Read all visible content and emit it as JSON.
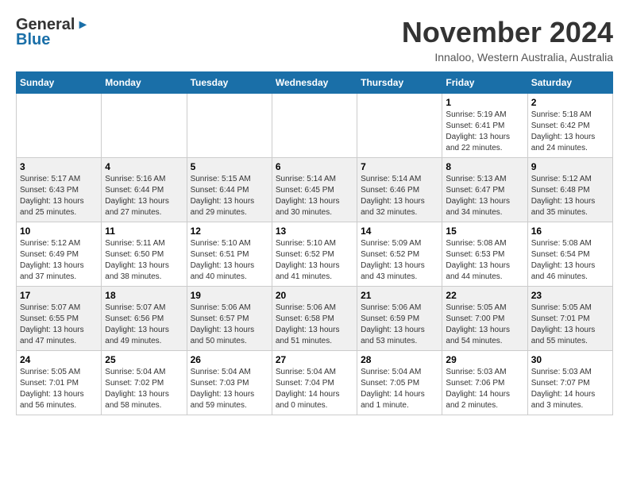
{
  "header": {
    "logo_general": "General",
    "logo_blue": "Blue",
    "month": "November 2024",
    "location": "Innaloo, Western Australia, Australia"
  },
  "weekdays": [
    "Sunday",
    "Monday",
    "Tuesday",
    "Wednesday",
    "Thursday",
    "Friday",
    "Saturday"
  ],
  "weeks": [
    [
      {
        "day": "",
        "info": ""
      },
      {
        "day": "",
        "info": ""
      },
      {
        "day": "",
        "info": ""
      },
      {
        "day": "",
        "info": ""
      },
      {
        "day": "",
        "info": ""
      },
      {
        "day": "1",
        "info": "Sunrise: 5:19 AM\nSunset: 6:41 PM\nDaylight: 13 hours and 22 minutes."
      },
      {
        "day": "2",
        "info": "Sunrise: 5:18 AM\nSunset: 6:42 PM\nDaylight: 13 hours and 24 minutes."
      }
    ],
    [
      {
        "day": "3",
        "info": "Sunrise: 5:17 AM\nSunset: 6:43 PM\nDaylight: 13 hours and 25 minutes."
      },
      {
        "day": "4",
        "info": "Sunrise: 5:16 AM\nSunset: 6:44 PM\nDaylight: 13 hours and 27 minutes."
      },
      {
        "day": "5",
        "info": "Sunrise: 5:15 AM\nSunset: 6:44 PM\nDaylight: 13 hours and 29 minutes."
      },
      {
        "day": "6",
        "info": "Sunrise: 5:14 AM\nSunset: 6:45 PM\nDaylight: 13 hours and 30 minutes."
      },
      {
        "day": "7",
        "info": "Sunrise: 5:14 AM\nSunset: 6:46 PM\nDaylight: 13 hours and 32 minutes."
      },
      {
        "day": "8",
        "info": "Sunrise: 5:13 AM\nSunset: 6:47 PM\nDaylight: 13 hours and 34 minutes."
      },
      {
        "day": "9",
        "info": "Sunrise: 5:12 AM\nSunset: 6:48 PM\nDaylight: 13 hours and 35 minutes."
      }
    ],
    [
      {
        "day": "10",
        "info": "Sunrise: 5:12 AM\nSunset: 6:49 PM\nDaylight: 13 hours and 37 minutes."
      },
      {
        "day": "11",
        "info": "Sunrise: 5:11 AM\nSunset: 6:50 PM\nDaylight: 13 hours and 38 minutes."
      },
      {
        "day": "12",
        "info": "Sunrise: 5:10 AM\nSunset: 6:51 PM\nDaylight: 13 hours and 40 minutes."
      },
      {
        "day": "13",
        "info": "Sunrise: 5:10 AM\nSunset: 6:52 PM\nDaylight: 13 hours and 41 minutes."
      },
      {
        "day": "14",
        "info": "Sunrise: 5:09 AM\nSunset: 6:52 PM\nDaylight: 13 hours and 43 minutes."
      },
      {
        "day": "15",
        "info": "Sunrise: 5:08 AM\nSunset: 6:53 PM\nDaylight: 13 hours and 44 minutes."
      },
      {
        "day": "16",
        "info": "Sunrise: 5:08 AM\nSunset: 6:54 PM\nDaylight: 13 hours and 46 minutes."
      }
    ],
    [
      {
        "day": "17",
        "info": "Sunrise: 5:07 AM\nSunset: 6:55 PM\nDaylight: 13 hours and 47 minutes."
      },
      {
        "day": "18",
        "info": "Sunrise: 5:07 AM\nSunset: 6:56 PM\nDaylight: 13 hours and 49 minutes."
      },
      {
        "day": "19",
        "info": "Sunrise: 5:06 AM\nSunset: 6:57 PM\nDaylight: 13 hours and 50 minutes."
      },
      {
        "day": "20",
        "info": "Sunrise: 5:06 AM\nSunset: 6:58 PM\nDaylight: 13 hours and 51 minutes."
      },
      {
        "day": "21",
        "info": "Sunrise: 5:06 AM\nSunset: 6:59 PM\nDaylight: 13 hours and 53 minutes."
      },
      {
        "day": "22",
        "info": "Sunrise: 5:05 AM\nSunset: 7:00 PM\nDaylight: 13 hours and 54 minutes."
      },
      {
        "day": "23",
        "info": "Sunrise: 5:05 AM\nSunset: 7:01 PM\nDaylight: 13 hours and 55 minutes."
      }
    ],
    [
      {
        "day": "24",
        "info": "Sunrise: 5:05 AM\nSunset: 7:01 PM\nDaylight: 13 hours and 56 minutes."
      },
      {
        "day": "25",
        "info": "Sunrise: 5:04 AM\nSunset: 7:02 PM\nDaylight: 13 hours and 58 minutes."
      },
      {
        "day": "26",
        "info": "Sunrise: 5:04 AM\nSunset: 7:03 PM\nDaylight: 13 hours and 59 minutes."
      },
      {
        "day": "27",
        "info": "Sunrise: 5:04 AM\nSunset: 7:04 PM\nDaylight: 14 hours and 0 minutes."
      },
      {
        "day": "28",
        "info": "Sunrise: 5:04 AM\nSunset: 7:05 PM\nDaylight: 14 hours and 1 minute."
      },
      {
        "day": "29",
        "info": "Sunrise: 5:03 AM\nSunset: 7:06 PM\nDaylight: 14 hours and 2 minutes."
      },
      {
        "day": "30",
        "info": "Sunrise: 5:03 AM\nSunset: 7:07 PM\nDaylight: 14 hours and 3 minutes."
      }
    ]
  ]
}
